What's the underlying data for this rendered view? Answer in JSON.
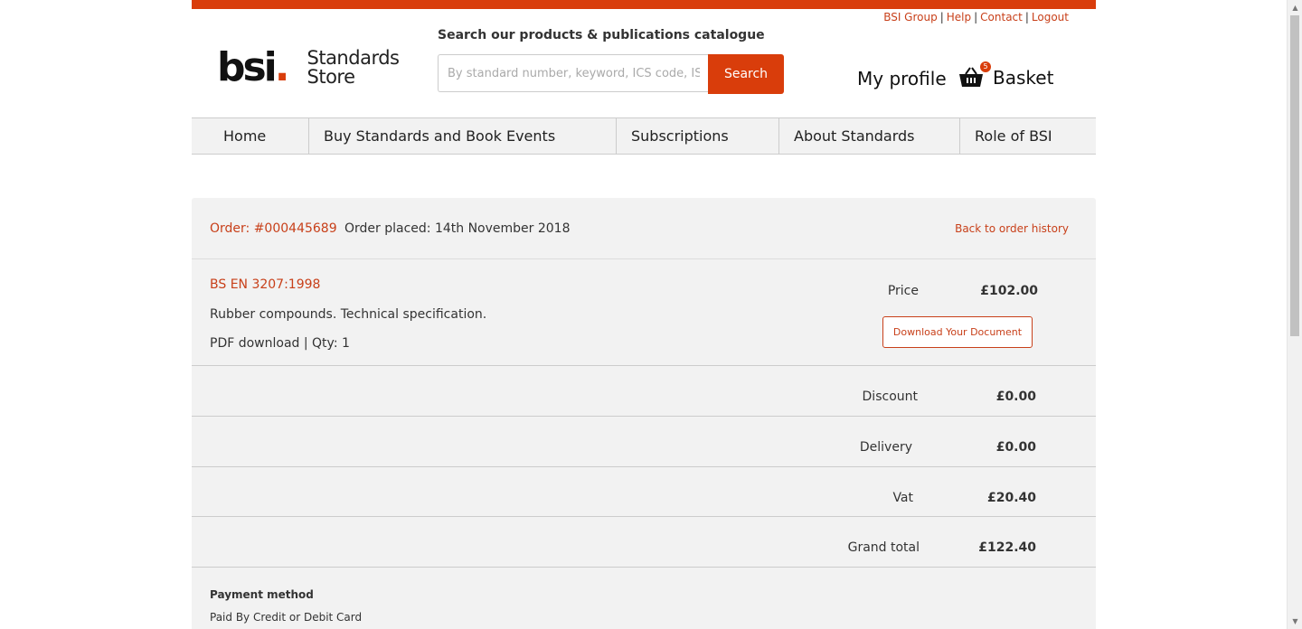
{
  "util_links": [
    "BSI Group",
    "Help",
    "Contact",
    "Logout"
  ],
  "logo": {
    "wordmark": "bsi",
    "dot": ".",
    "line1": "Standards",
    "line2": "Store"
  },
  "search": {
    "label": "Search our products & publications catalogue",
    "placeholder": "By standard number, keyword, ICS code, ISBN",
    "button": "Search"
  },
  "header": {
    "profile": "My profile",
    "basket": "Basket",
    "basket_count": "5"
  },
  "nav": [
    "Home",
    "Buy Standards and Book Events",
    "Subscriptions",
    "About Standards",
    "Role of BSI"
  ],
  "order": {
    "number": "Order: #000445689",
    "placed": "Order placed: 14th November 2018",
    "back": "Back to order history"
  },
  "product": {
    "code": "BS EN 3207:1998",
    "description": "Rubber compounds. Technical specification.",
    "format": "PDF download | Qty: 1",
    "price_label": "Price",
    "price": "£102.00",
    "download": "Download Your Document"
  },
  "totals": {
    "discount_label": "Discount",
    "discount": "£0.00",
    "delivery_label": "Delivery",
    "delivery": "£0.00",
    "vat_label": "Vat",
    "vat": "£20.40",
    "grand_label": "Grand total",
    "grand": "£122.40"
  },
  "payment": {
    "title": "Payment method",
    "value": "Paid By Credit or Debit Card"
  },
  "colors": {
    "accent": "#d93d0b",
    "link": "#c8401a",
    "panel": "#f2f2f2"
  }
}
